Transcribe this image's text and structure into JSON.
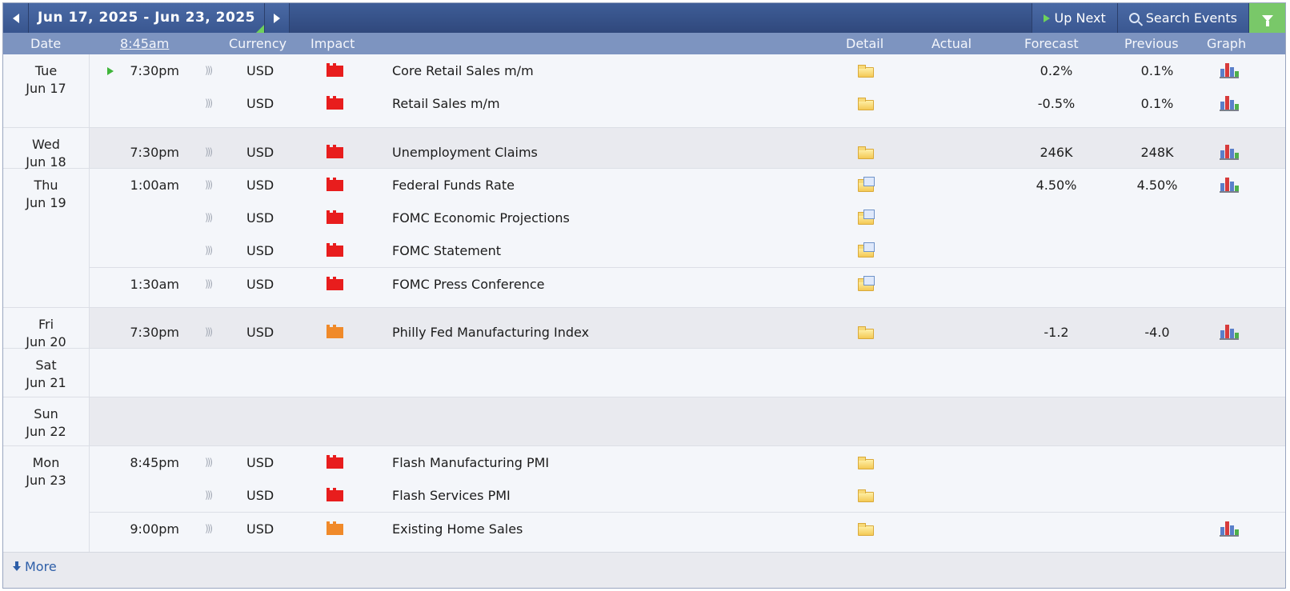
{
  "nav": {
    "date_range": "Jun 17, 2025 - Jun 23, 2025",
    "up_next_label": "Up Next",
    "search_label": "Search Events"
  },
  "columns": {
    "date": "Date",
    "time": "8:45am",
    "currency": "Currency",
    "impact": "Impact",
    "detail": "Detail",
    "actual": "Actual",
    "forecast": "Forecast",
    "previous": "Previous",
    "graph": "Graph"
  },
  "colors": {
    "high_impact": "#e81d1d",
    "medium_impact": "#f08a2a",
    "header": "#7d94c0",
    "topbar": "#3a5791"
  },
  "days": [
    {
      "weekday": "Tue",
      "date": "Jun 17",
      "events": [
        {
          "time": "7:30pm",
          "next": true,
          "currency": "USD",
          "impact": "high",
          "title": "Core Retail Sales m/m",
          "detail": "folder-icon",
          "actual": "",
          "forecast": "0.2%",
          "previous": "0.1%",
          "graph": true
        },
        {
          "time": "",
          "currency": "USD",
          "impact": "high",
          "title": "Retail Sales m/m",
          "detail": "folder-icon",
          "actual": "",
          "forecast": "-0.5%",
          "previous": "0.1%",
          "graph": true
        }
      ]
    },
    {
      "weekday": "Wed",
      "date": "Jun 18",
      "events": [
        {
          "time": "7:30pm",
          "currency": "USD",
          "impact": "high",
          "title": "Unemployment Claims",
          "detail": "folder-icon",
          "actual": "",
          "forecast": "246K",
          "previous": "248K",
          "graph": true
        }
      ]
    },
    {
      "weekday": "Thu",
      "date": "Jun 19",
      "events": [
        {
          "time": "1:00am",
          "currency": "USD",
          "impact": "high",
          "title": "Federal Funds Rate",
          "detail": "folder-doc-icon",
          "actual": "",
          "forecast": "4.50%",
          "previous": "4.50%",
          "graph": true
        },
        {
          "time": "",
          "currency": "USD",
          "impact": "high",
          "title": "FOMC Economic Projections",
          "detail": "folder-doc-icon",
          "actual": "",
          "forecast": "",
          "previous": "",
          "graph": false
        },
        {
          "time": "",
          "currency": "USD",
          "impact": "high",
          "title": "FOMC Statement",
          "detail": "folder-doc-icon",
          "actual": "",
          "forecast": "",
          "previous": "",
          "graph": false
        },
        {
          "time": "1:30am",
          "currency": "USD",
          "impact": "high",
          "title": "FOMC Press Conference",
          "detail": "folder-doc-icon",
          "actual": "",
          "forecast": "",
          "previous": "",
          "graph": false,
          "sep": true
        }
      ]
    },
    {
      "weekday": "Fri",
      "date": "Jun 20",
      "events": [
        {
          "time": "7:30pm",
          "currency": "USD",
          "impact": "medium",
          "title": "Philly Fed Manufacturing Index",
          "detail": "folder-icon",
          "actual": "",
          "forecast": "-1.2",
          "previous": "-4.0",
          "graph": true
        }
      ]
    },
    {
      "weekday": "Sat",
      "date": "Jun 21",
      "events": []
    },
    {
      "weekday": "Sun",
      "date": "Jun 22",
      "events": []
    },
    {
      "weekday": "Mon",
      "date": "Jun 23",
      "events": [
        {
          "time": "8:45pm",
          "currency": "USD",
          "impact": "high",
          "title": "Flash Manufacturing PMI",
          "detail": "folder-icon",
          "actual": "",
          "forecast": "",
          "previous": "",
          "graph": false
        },
        {
          "time": "",
          "currency": "USD",
          "impact": "high",
          "title": "Flash Services PMI",
          "detail": "folder-icon",
          "actual": "",
          "forecast": "",
          "previous": "",
          "graph": false
        },
        {
          "time": "9:00pm",
          "currency": "USD",
          "impact": "medium",
          "title": "Existing Home Sales",
          "detail": "folder-icon",
          "actual": "",
          "forecast": "",
          "previous": "",
          "graph": true,
          "sep": true
        }
      ]
    }
  ],
  "footer": {
    "more_label": "More"
  }
}
